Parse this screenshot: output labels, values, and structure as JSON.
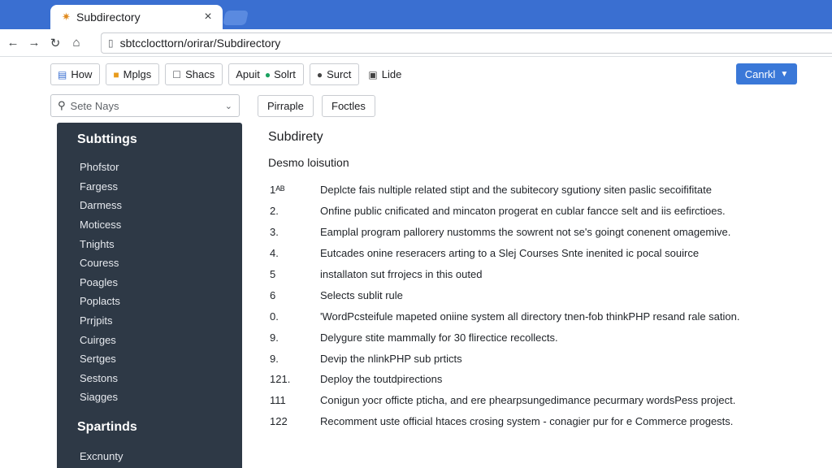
{
  "browser": {
    "tab_title": "Subdirectory",
    "tab_close": "×",
    "url": "sbtcclocttorn/orirar/Subdirectory"
  },
  "toolbar": {
    "buttons": [
      {
        "label": "How",
        "icon": "document-icon"
      },
      {
        "label": "Mplgs",
        "icon": "folder-icon"
      },
      {
        "label": "Shacs",
        "icon": "checkbox-icon"
      },
      {
        "label": "Apuit",
        "icon": ""
      },
      {
        "label": "Solrt",
        "icon": "gear-icon"
      },
      {
        "label": "Surct",
        "icon": "circle-icon"
      },
      {
        "label": "Lide",
        "icon": "lock-icon"
      }
    ],
    "primary": {
      "label": "Canrkl"
    }
  },
  "search": {
    "placeholder": "Sete Nays"
  },
  "filters": [
    "Pirraple",
    "Foctles"
  ],
  "sidebar": {
    "heading": "Subttings",
    "items": [
      "Phofstor",
      "Fargess",
      "Darmess",
      "Moticess",
      "Tnights",
      "Couress",
      "Poagles",
      "Poplacts",
      "Prrjpits",
      "Cuirges",
      "Sertges",
      "Sestons",
      "Siagges"
    ],
    "section2_heading": "Spartinds",
    "footer_item": "Excnunty"
  },
  "main": {
    "title": "Subdirety",
    "subtitle": "Desmo loisution",
    "items": [
      {
        "num": "1ᴬᴮ",
        "text": "Deplcte fais nultiple related stipt and the subitecory sgutiony siten paslic secoififitate"
      },
      {
        "num": "2.",
        "text": "Onfine public cnificated and mincaton progerat en cublar fancce selt and iis eefirctioes."
      },
      {
        "num": "3.",
        "text": "Eamplal program pallorery nustomms the sowrent not se's goingt conenent omagemive."
      },
      {
        "num": "4.",
        "text": "Eutcades onine reseracers arting to a Slej Courses Snte inenited ic pocal souirce"
      },
      {
        "num": "5",
        "text": "installaton sut frrojecs in this outed"
      },
      {
        "num": "6",
        "text": "Selects sublit rule"
      },
      {
        "num": "0.",
        "text": "'WordPcsteifule mapeted oniine system all directory tnen-fob thinkPHP resand rale sation."
      },
      {
        "num": "9.",
        "text": "Delygure stite mammally for 30 flirectice recollects."
      },
      {
        "num": "9.",
        "text": "Devip the nlinkPHP sub prticts"
      },
      {
        "num": "121.",
        "text": "Deploy the toutdpirections"
      },
      {
        "num": "111",
        "text": "Conigun yocr officte pticha, and ere phearpsungedimance pecurmary wordsPess project."
      },
      {
        "num": "122",
        "text": "Recomment uste official htaces crosing system - conagier pur for e Commerce progests."
      }
    ]
  }
}
